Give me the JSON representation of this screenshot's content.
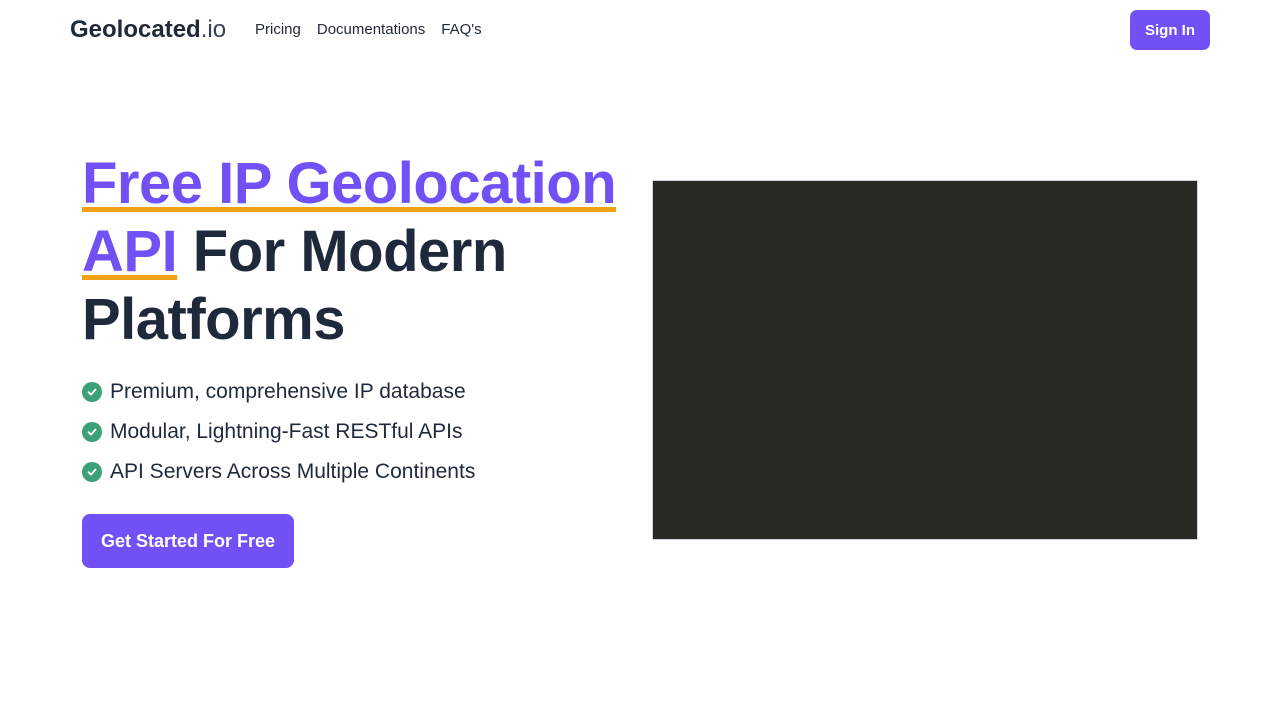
{
  "nav": {
    "logo_bold": "Geolocated",
    "logo_light": ".io",
    "links": [
      "Pricing",
      "Documentations",
      "FAQ's"
    ],
    "signin_label": "Sign In"
  },
  "hero": {
    "title_highlight_1": "Free IP Geolocation",
    "title_highlight_2": "API",
    "title_rest_1": " For Modern",
    "title_rest_2": "Platforms",
    "features": [
      "Premium, comprehensive IP database",
      "Modular, Lightning-Fast RESTful APIs",
      "API Servers Across Multiple Continents"
    ],
    "cta_label": "Get Started For Free"
  },
  "icons": {
    "feature_icon": "check-circle-icon"
  },
  "colors": {
    "accent": "#7150f5",
    "underline": "#f0a016",
    "check": "#3aa176",
    "video_bg": "#292a24"
  }
}
